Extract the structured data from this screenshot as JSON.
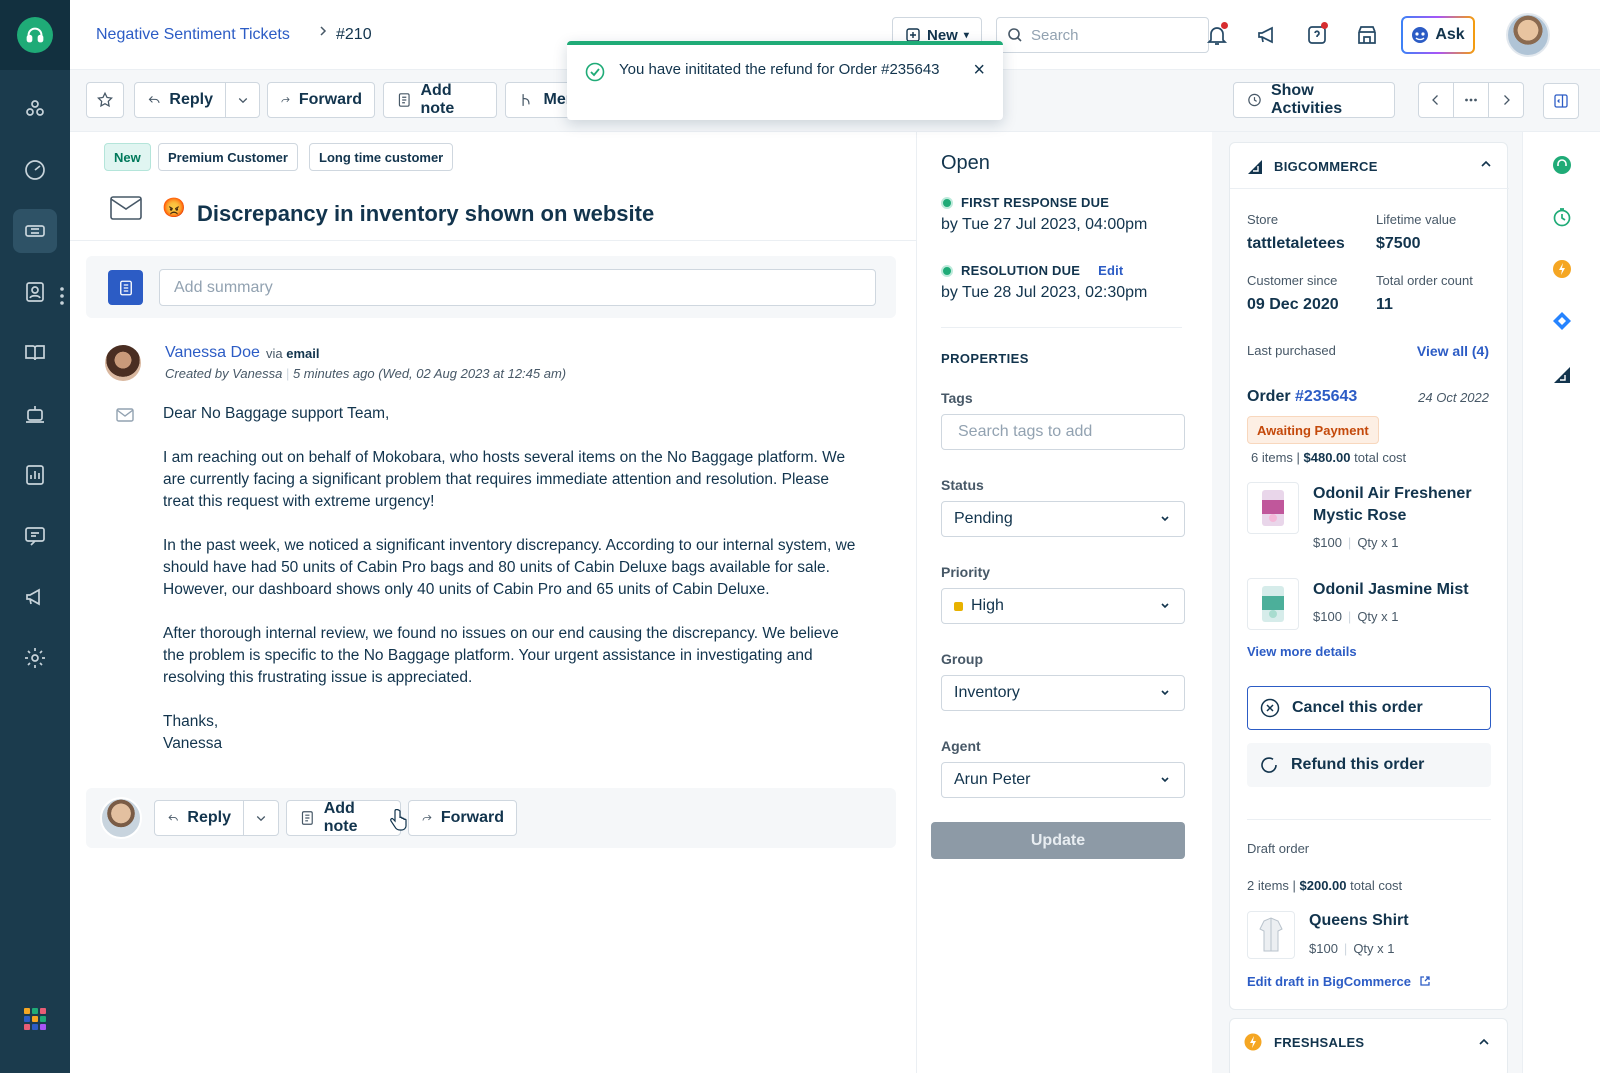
{
  "nav": {
    "items": [
      "logo",
      "social",
      "dashboard",
      "tickets",
      "contacts",
      "solutions",
      "automation",
      "analytics",
      "feedback",
      "campaigns",
      "admin"
    ]
  },
  "header": {
    "breadcrumb_view": "Negative Sentiment Tickets",
    "breadcrumb_sep": ">",
    "ticket_id": "#210",
    "new_label": "New",
    "search_placeholder": "Search",
    "ask_label": "Ask"
  },
  "toolbar": {
    "reply": "Reply",
    "forward": "Forward",
    "add_note": "Add note",
    "merge": "Mer",
    "show_activities": "Show Activities"
  },
  "toast": {
    "message": "You have inititated the refund for Order #235643",
    "close": "×"
  },
  "ticket": {
    "tags": [
      "New",
      "Premium Customer",
      "Long time customer"
    ],
    "emoji": "😡",
    "subject": "Discrepancy in inventory shown on website",
    "summary_placeholder": "Add summary",
    "sender_name": "Vanessa Doe",
    "via_prefix": "via",
    "via_channel": "email",
    "meta_created": "Created by Vanessa",
    "meta_sep": "|",
    "meta_time": "5 minutes ago (Wed, 02 Aug 2023 at 12:45 am)",
    "body": {
      "greeting": "Dear No Baggage support Team,",
      "p1": "I am reaching out on behalf of Mokobara, who hosts several items on the No Baggage platform. We are currently facing a significant problem that requires immediate attention and resolution. Please treat this request with extreme urgency!",
      "p2": "In the past week, we noticed a significant inventory discrepancy. According to our internal system, we should have had 50 units of Cabin Pro bags and 80 units of Cabin Deluxe bags available for sale. However, our dashboard shows only 40 units of Cabin Pro and 65 units of Cabin Deluxe.",
      "p3": "After thorough internal review, we found no issues on our end causing the discrepancy. We believe the problem is specific to the No Baggage platform. Your urgent assistance in investigating and resolving this frustrating issue is appreciated.",
      "signoff": "Thanks,",
      "signature": "Vanessa"
    },
    "reply_bar": {
      "reply": "Reply",
      "add_note": "Add note",
      "forward": "Forward"
    }
  },
  "properties": {
    "status_title": "Open",
    "first_response_label": "FIRST RESPONSE DUE",
    "first_response_value": "by Tue 27 Jul 2023, 04:00pm",
    "resolution_label": "RESOLUTION DUE",
    "resolution_edit": "Edit",
    "resolution_value": "by Tue 28 Jul 2023, 02:30pm",
    "heading": "PROPERTIES",
    "tags_label": "Tags",
    "tags_placeholder": "Search tags to add",
    "status_label": "Status",
    "status_value": "Pending",
    "priority_label": "Priority",
    "priority_value": "High",
    "priority_color": "#e8b200",
    "group_label": "Group",
    "group_value": "Inventory",
    "agent_label": "Agent",
    "agent_value": "Arun Peter",
    "update_label": "Update"
  },
  "bigcommerce": {
    "title": "BIGCOMMERCE",
    "store_label": "Store",
    "store_value": "tattletaletees",
    "ltv_label": "Lifetime value",
    "ltv_value": "$7500",
    "since_label": "Customer since",
    "since_value": "09 Dec 2020",
    "orders_label": "Total order count",
    "orders_value": "11",
    "last_purchased_label": "Last purchased",
    "view_all": "View all (4)",
    "order_prefix": "Order",
    "order_number": "#235643",
    "order_date": "24 Oct 2022",
    "order_status": "Awaiting Payment",
    "order_items_count": "6 items",
    "order_total": "$480.00",
    "total_cost_suffix": "total cost",
    "products": [
      {
        "name": "Odonil Air Freshener Mystic Rose",
        "price": "$100",
        "qty": "Qty x 1"
      },
      {
        "name": "Odonil Jasmine Mist",
        "price": "$100",
        "qty": "Qty x 1"
      }
    ],
    "view_more": "View more details",
    "cancel_label": "Cancel this order",
    "refund_label": "Refund this order",
    "draft_label": "Draft order",
    "draft_items_count": "2 items",
    "draft_total": "$200.00",
    "draft_product": {
      "name": "Queens Shirt",
      "price": "$100",
      "qty": "Qty x 1"
    },
    "edit_draft": "Edit draft in BigCommerce"
  },
  "freshsales": {
    "title": "FRESHSALES"
  },
  "colors": {
    "brand_green": "#1fab77",
    "link_blue": "#2c5cc5",
    "nav_bg": "#1b3b4d"
  }
}
